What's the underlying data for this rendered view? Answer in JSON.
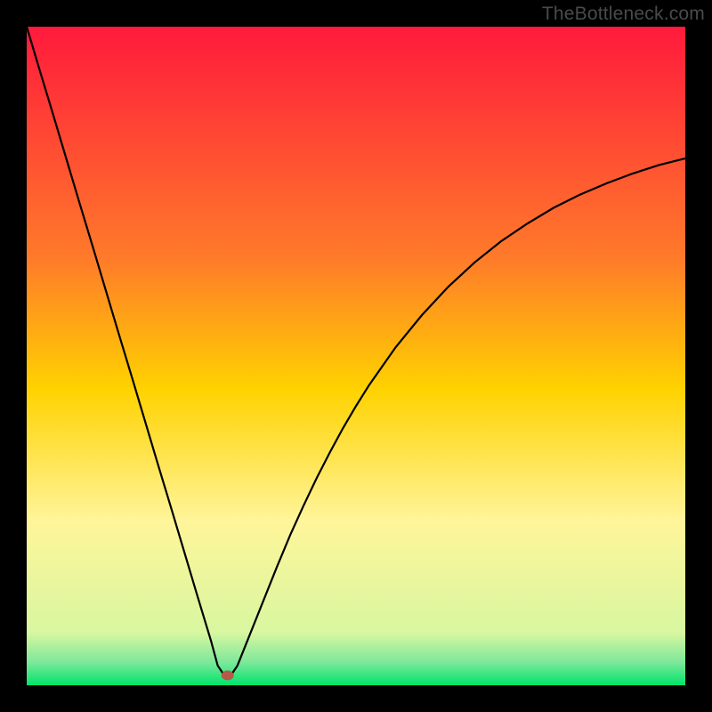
{
  "watermark": "TheBottleneck.com",
  "chart_data": {
    "type": "line",
    "title": "",
    "xlabel": "",
    "ylabel": "",
    "xlim": [
      0,
      100
    ],
    "ylim": [
      0,
      100
    ],
    "gradient_stops": [
      {
        "offset": 0,
        "color": "#ff1a3c"
      },
      {
        "offset": 35,
        "color": "#ff7a2a"
      },
      {
        "offset": 55,
        "color": "#ffd200"
      },
      {
        "offset": 75,
        "color": "#fff59a"
      },
      {
        "offset": 92,
        "color": "#d8f7a0"
      },
      {
        "offset": 96.5,
        "color": "#7de89a"
      },
      {
        "offset": 100,
        "color": "#00e46a"
      }
    ],
    "series": [
      {
        "name": "bottleneck-curve",
        "color": "#000000",
        "x": [
          0,
          2,
          4,
          6,
          8,
          10,
          12,
          14,
          16,
          18,
          20,
          22,
          24,
          26,
          28,
          29,
          30,
          31,
          32,
          34,
          36,
          38,
          40,
          42,
          44,
          46,
          48,
          50,
          52,
          56,
          60,
          64,
          68,
          72,
          76,
          80,
          84,
          88,
          92,
          96,
          100
        ],
        "y": [
          100,
          93.3,
          86.7,
          80.0,
          73.3,
          66.7,
          60.0,
          53.3,
          46.7,
          40.0,
          33.3,
          26.7,
          20.0,
          13.3,
          6.7,
          3.0,
          1.5,
          1.5,
          3.0,
          8.0,
          13.0,
          18.0,
          22.8,
          27.2,
          31.4,
          35.3,
          39.0,
          42.4,
          45.6,
          51.3,
          56.2,
          60.5,
          64.2,
          67.4,
          70.1,
          72.5,
          74.5,
          76.2,
          77.7,
          79.0,
          80.0
        ]
      }
    ],
    "marker": {
      "name": "optimal-point",
      "x": 30.5,
      "y": 1.5,
      "color": "#b55a4a",
      "radius_px": 6
    }
  }
}
